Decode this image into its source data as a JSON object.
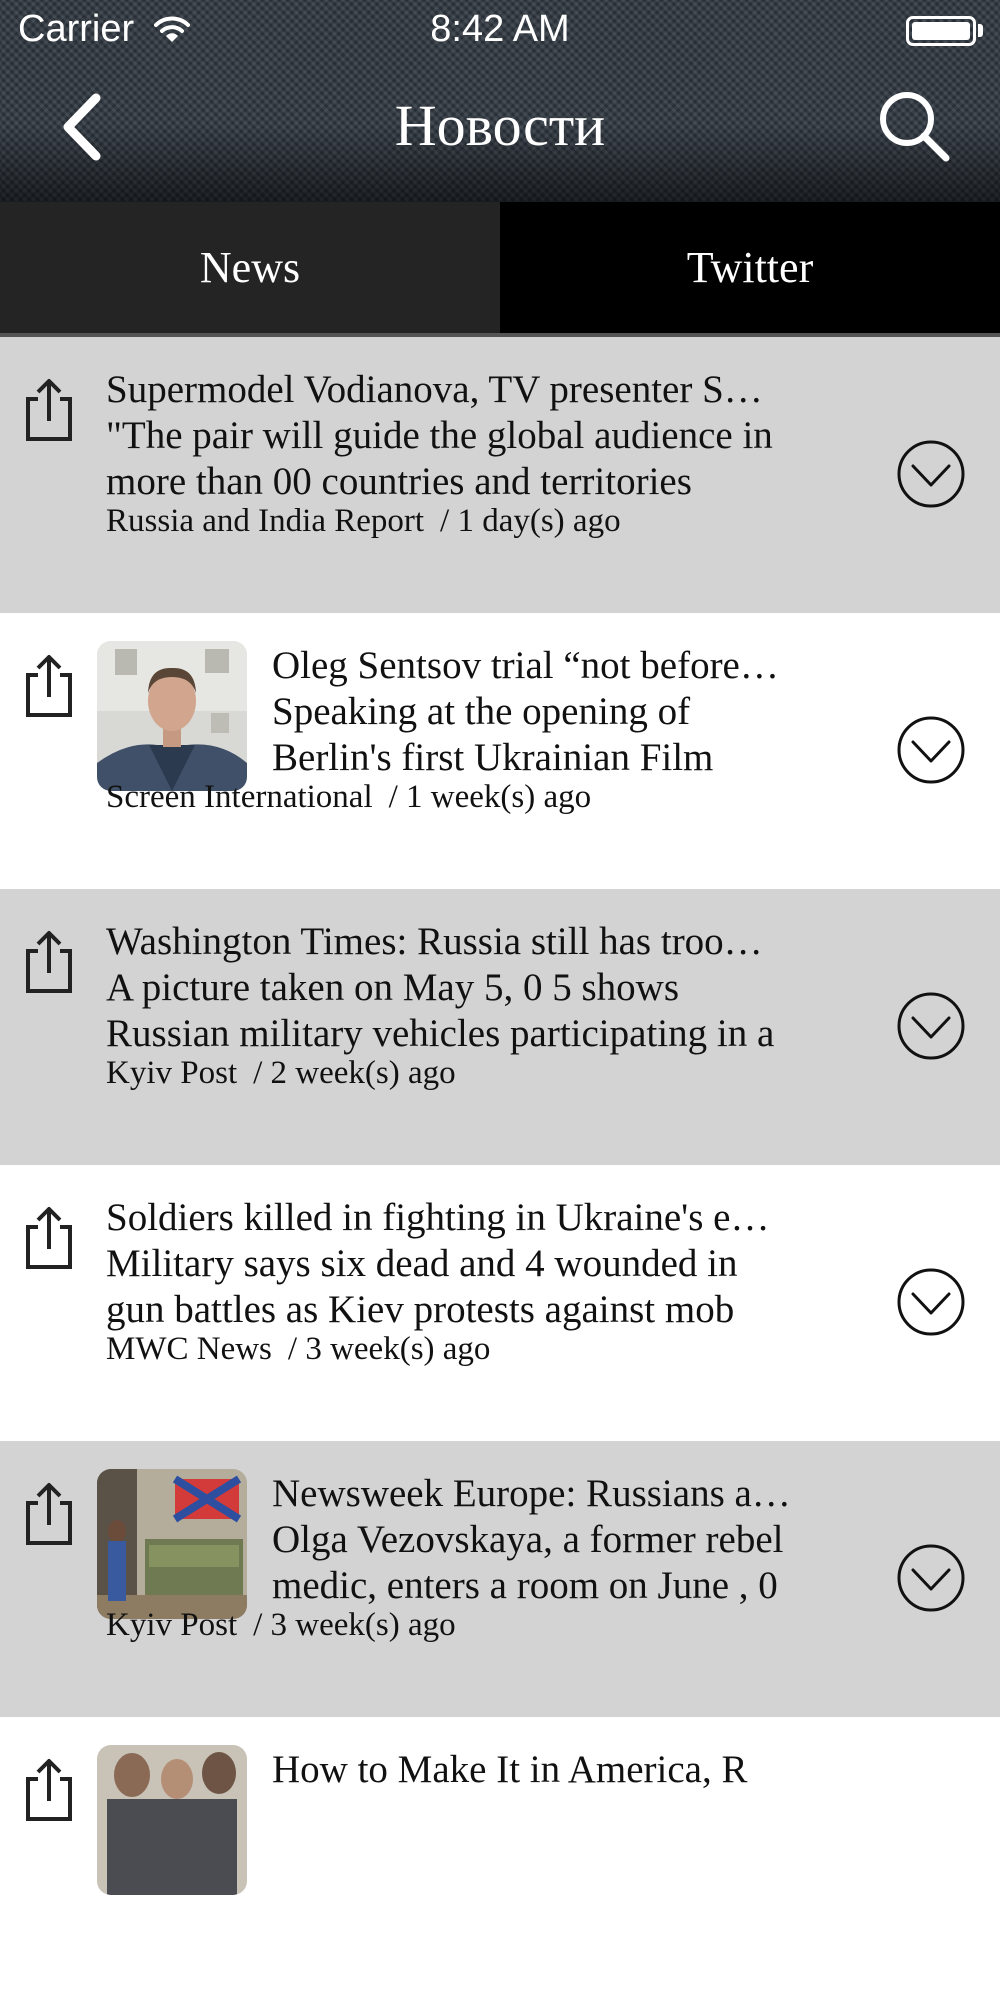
{
  "status": {
    "carrier": "Carrier",
    "time": "8:42 AM"
  },
  "nav": {
    "title": "Новости",
    "back_icon": "chevron-left-icon",
    "search_icon": "search-icon"
  },
  "tabs": [
    {
      "label": "News",
      "selected": true
    },
    {
      "label": "Twitter",
      "selected": false
    }
  ],
  "colors": {
    "row_gray": "#d3d3d3",
    "row_white": "#ffffff",
    "tab_selected": "#242424",
    "tab_unselected": "#000000"
  },
  "items": [
    {
      "title": "Supermodel Vodianova, TV presenter S…",
      "summary_line1": "\"The pair will guide the global audience in",
      "summary_line2": "more than 00 countries and territories",
      "source": "Russia and India Report",
      "age": "/ 1 day(s) ago"
    },
    {
      "title": "Oleg Sentsov trial “not before…",
      "summary_line1": "Speaking at the opening of",
      "summary_line2": "Berlin's first Ukrainian Film",
      "source": "Screen International",
      "age": "/ 1 week(s) ago"
    },
    {
      "title": "Washington Times: Russia still has troo…",
      "summary_line1": "A picture taken on May 5, 0 5 shows",
      "summary_line2": "Russian military vehicles participating in a",
      "source": "Kyiv Post",
      "age": "/ 2 week(s) ago"
    },
    {
      "title": "Soldiers killed in fighting in Ukraine's e…",
      "summary_line1": "Military says six dead and 4 wounded in",
      "summary_line2": "gun battles as Kiev protests against mob",
      "source": "MWC News",
      "age": "/ 3 week(s) ago"
    },
    {
      "title": "Newsweek Europe: Russians a…",
      "summary_line1": "Olga Vezovskaya, a former rebel",
      "summary_line2": "medic, enters a room on June , 0",
      "source": "Kyiv Post",
      "age": "/ 3 week(s) ago"
    },
    {
      "title": "How to Make It in America, R",
      "summary_line1": "",
      "summary_line2": "",
      "source": "",
      "age": ""
    }
  ]
}
